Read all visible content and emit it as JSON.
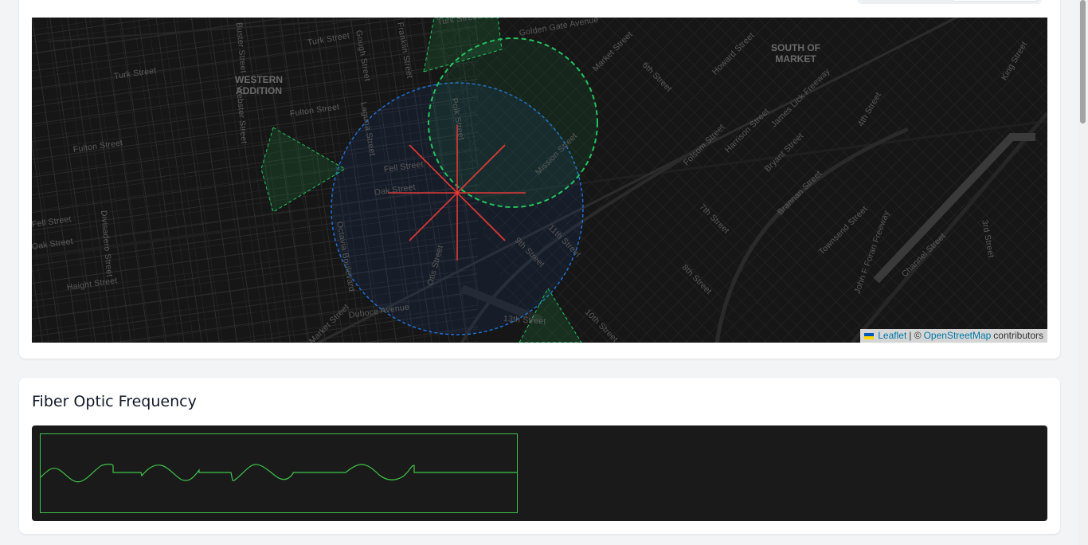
{
  "map": {
    "districts": [
      {
        "line1": "WESTERN",
        "line2": "ADDITION"
      },
      {
        "line1": "SOUTH OF",
        "line2": "MARKET"
      }
    ],
    "streets": [
      {
        "text": "Turk Street"
      },
      {
        "text": "Turk Street"
      },
      {
        "text": "Turk Street"
      },
      {
        "text": "Golden Gate Avenue"
      },
      {
        "text": "Fulton Street"
      },
      {
        "text": "Fulton Street"
      },
      {
        "text": "Fell Street"
      },
      {
        "text": "Fell Street"
      },
      {
        "text": "Oak Street"
      },
      {
        "text": "Oak Street"
      },
      {
        "text": "Haight Street"
      },
      {
        "text": "Duboce Avenue"
      },
      {
        "text": "13th Street"
      },
      {
        "text": "Market Street"
      },
      {
        "text": "Market Street"
      },
      {
        "text": "Octavia Boulevard"
      },
      {
        "text": "Otis Street"
      },
      {
        "text": "Polk Street"
      },
      {
        "text": "Mission Street"
      },
      {
        "text": "Folsom Street"
      },
      {
        "text": "Howard Street"
      },
      {
        "text": "Harrison Street"
      },
      {
        "text": "Bryant Street"
      },
      {
        "text": "Brannan Street"
      },
      {
        "text": "Townsend Street"
      },
      {
        "text": "Channel Street"
      },
      {
        "text": "King Street"
      },
      {
        "text": "3rd Street"
      },
      {
        "text": "4th Street"
      },
      {
        "text": "6th Street"
      },
      {
        "text": "7th Street"
      },
      {
        "text": "8th Street"
      },
      {
        "text": "9th Street"
      },
      {
        "text": "10th Street"
      },
      {
        "text": "11th Street"
      },
      {
        "text": "James Lick Freeway"
      },
      {
        "text": "John F Foran Freeway"
      },
      {
        "text": "Divisadero Street"
      },
      {
        "text": "Webster Street"
      },
      {
        "text": "Gough Street"
      },
      {
        "text": "Franklin Street"
      },
      {
        "text": "Laguna Street"
      },
      {
        "text": "Buster Street"
      }
    ],
    "attribution": {
      "leaflet": "Leaflet",
      "separator": "| ©",
      "osm": "OpenStreetMap",
      "suffix": "contributors"
    },
    "colors": {
      "background": "#161616",
      "blue_circle": "#1f6fd6",
      "green_circle": "#22c55e",
      "red_marker": "#e53935"
    }
  },
  "fiber": {
    "title": "Fiber Optic Frequency",
    "waveform_color": "#3ec34a"
  }
}
